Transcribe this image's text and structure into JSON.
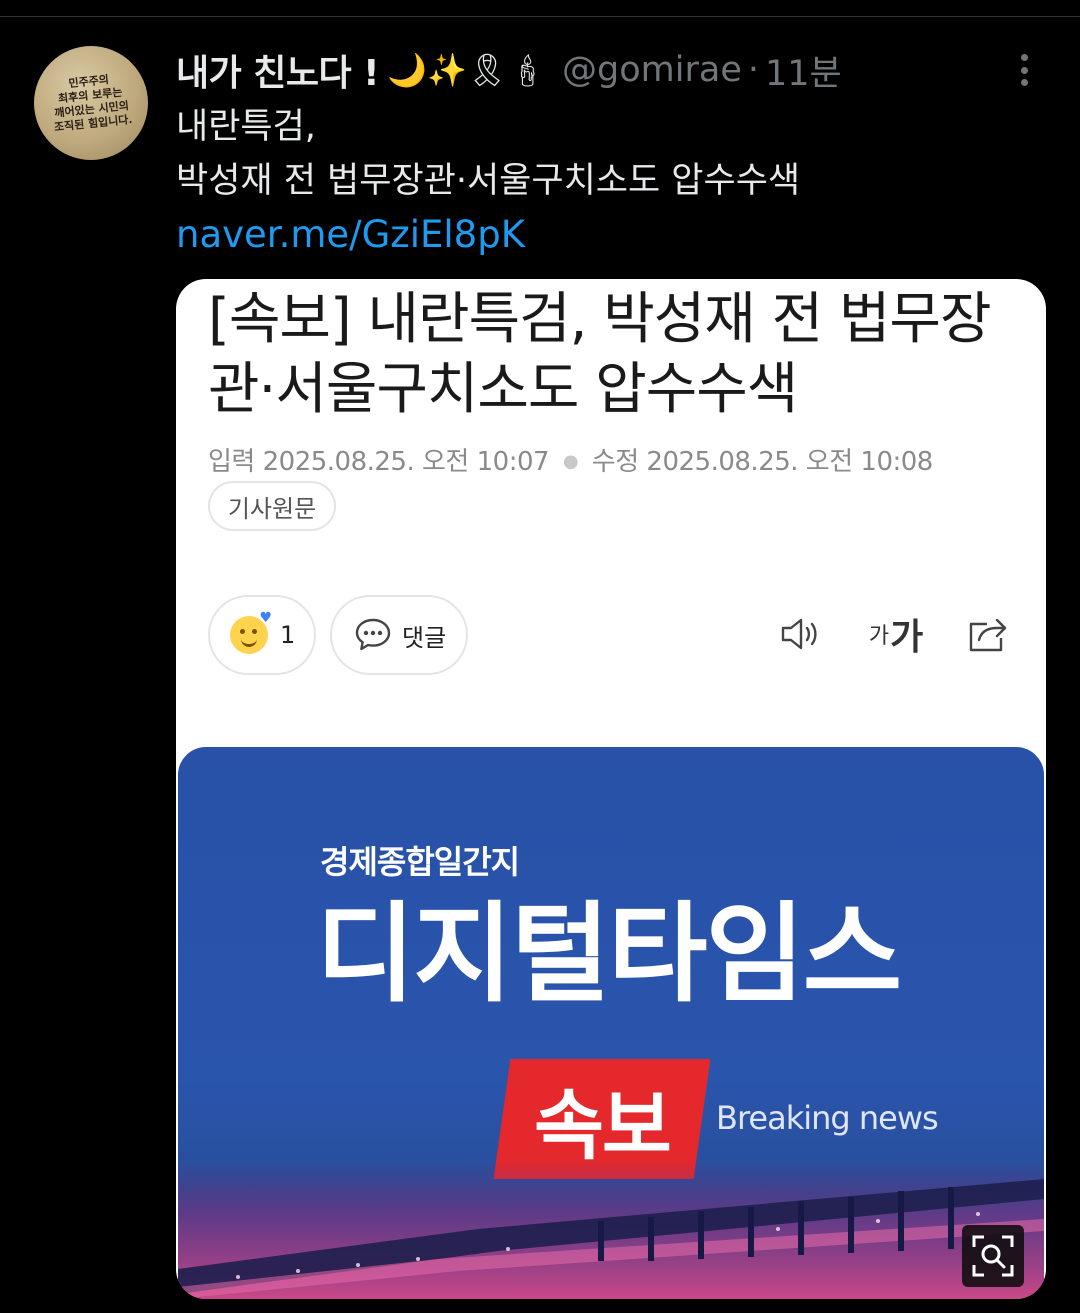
{
  "tweet": {
    "display_name": "내가 친노다 !",
    "name_emojis": "🌙✨🎗🕯",
    "handle": "@gomirae",
    "separator": "·",
    "time": "11분",
    "text_line1": "내란특검,",
    "text_line2": "박성재 전 법무장관·서울구치소도 압수수색",
    "link": "naver.me/GziEl8pK"
  },
  "avatar": {
    "line1": "민주주의",
    "line2": "최후의 보루는",
    "line3": "깨어있는 시민의",
    "line4": "조직된 힘입니다."
  },
  "card": {
    "headline_line1": "[속보] 내란특검, 박성재 전 법무장",
    "headline_line2": "관·서울구치소도 압수수색",
    "input_label": "입력",
    "input_date": "2025.08.25. 오전 10:07",
    "edit_label": "수정",
    "edit_date": "2025.08.25. 오전 10:08",
    "original_label": "기사원문",
    "reaction_count": "1",
    "comment_label": "댓글",
    "font_small": "가",
    "font_big": "가"
  },
  "banner": {
    "subtitle": "경제종합일간지",
    "title": "디지털타임스",
    "badge": "속보",
    "english": "Breaking news"
  },
  "colors": {
    "link": "#1d9bf0",
    "muted": "#71767b",
    "banner_blue": "#2a55ad",
    "badge_red": "#e5282c"
  },
  "icons": [
    "more-vertical-icon",
    "smiley-reaction-icon",
    "comment-bubble-icon",
    "speaker-icon",
    "font-size-icon",
    "share-icon",
    "zoom-search-icon"
  ]
}
